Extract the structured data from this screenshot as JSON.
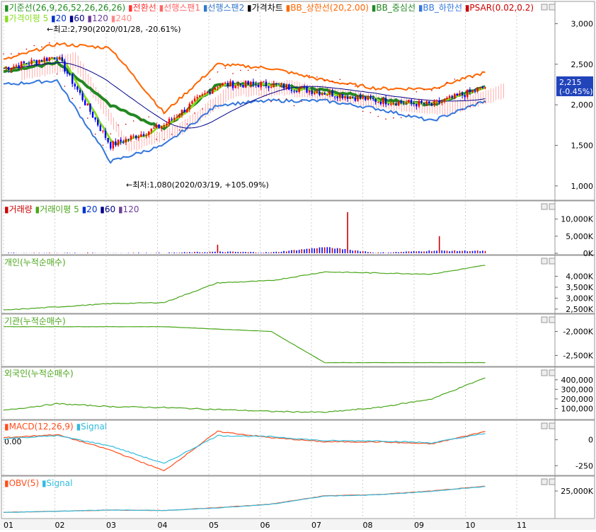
{
  "colors": {
    "kijun": "#1e8c1e",
    "tenkan": "#ff3333",
    "span1": "#ff6666",
    "span2": "#3377cc",
    "price_up": "#ff0000",
    "price_down": "#0000ff",
    "bb_upper": "#ff6600",
    "bb_mid": "#228822",
    "bb_lower": "#3377dd",
    "psar": "#cc0000",
    "ma5": "#88dd22",
    "ma20": "#0033cc",
    "ma60": "#000088",
    "ma120": "#6a3d9a",
    "ma240": "#ff8a8a",
    "vol": "#cc0000",
    "macd": "#ff4d1a",
    "signal": "#33bbdd",
    "obv": "#ff4d1a",
    "cum": "#4aa61a",
    "grid": "#cfcfcf",
    "axis_bg": "#ffffff"
  },
  "price_panel": {
    "legend1": [
      {
        "text": "기준선(26,9,26,52,26,26,26)",
        "color": "#1e8c1e"
      },
      {
        "text": "전환선",
        "color": "#ff3333"
      },
      {
        "text": "선행스팬1",
        "color": "#ff6666"
      },
      {
        "text": "선행스팬2",
        "color": "#3377cc"
      },
      {
        "text": "가격차트",
        "color": "#000000"
      },
      {
        "text": "BB_상한선(20,2.00)",
        "color": "#ff6600"
      },
      {
        "text": "BB_중심선",
        "color": "#228822"
      },
      {
        "text": "BB_하한선",
        "color": "#3377dd"
      },
      {
        "text": "PSAR(0.02,0.2)",
        "color": "#cc0000"
      }
    ],
    "legend2": [
      {
        "text": "가격이평 5",
        "color": "#88dd22"
      },
      {
        "text": "20",
        "color": "#0033cc"
      },
      {
        "text": "60",
        "color": "#000088"
      },
      {
        "text": "120",
        "color": "#6a3d9a"
      },
      {
        "text": "240",
        "color": "#ff8a8a"
      }
    ],
    "high_annotation": "←최고:2,790(2020/01/28, -20.61%)",
    "low_annotation": "←최저:1,080(2020/03/19, +105.09%)",
    "yticks": [
      "3,000",
      "2,500",
      "2,000",
      "1,500",
      "1,000"
    ],
    "current_price": "2,215",
    "current_change": "(-0.45%)"
  },
  "volume_panel": {
    "legend": [
      {
        "text": "거래량",
        "color": "#cc0000"
      },
      {
        "text": "거래이평 5",
        "color": "#4aa61a"
      },
      {
        "text": "20",
        "color": "#0033cc"
      },
      {
        "text": "60",
        "color": "#000088"
      },
      {
        "text": "120",
        "color": "#6a3d9a"
      }
    ],
    "yticks": [
      "10,000K",
      "5,000K",
      "0K"
    ]
  },
  "retail_panel": {
    "legend": "개인(누적순매수)",
    "yticks": [
      "4,000K",
      "3,500K",
      "3,000K",
      "2,500K"
    ]
  },
  "inst_panel": {
    "legend": "기관(누적순매수)",
    "yticks": [
      "-2,000K",
      "-2,500K"
    ]
  },
  "foreign_panel": {
    "legend": "외국인(누적순매수)",
    "yticks": [
      "400,000",
      "300,000",
      "200,000",
      "100,000"
    ]
  },
  "macd_panel": {
    "legend": [
      {
        "text": "MACD(12,26,9)",
        "color": "#ff4d1a"
      },
      {
        "text": "Signal",
        "color": "#33bbdd"
      }
    ],
    "zero_label": "0.00",
    "yticks": [
      "0",
      "-250"
    ]
  },
  "obv_panel": {
    "legend": [
      {
        "text": "OBV(5)",
        "color": "#ff4d1a"
      },
      {
        "text": "Signal",
        "color": "#33bbdd"
      }
    ],
    "yticks": [
      "25,000K"
    ]
  },
  "x_axis": [
    "01",
    "02",
    "03",
    "04",
    "05",
    "06",
    "07",
    "08",
    "09",
    "10",
    "11"
  ],
  "chart_data": [
    {
      "type": "line",
      "title": "",
      "series": [
        {
          "name": "가격차트",
          "kind": "candlestick",
          "x": [
            "01",
            "02",
            "03",
            "04",
            "05",
            "06",
            "07",
            "08",
            "09",
            "10"
          ],
          "values": [
            2450,
            2600,
            1500,
            1750,
            2250,
            2250,
            2150,
            2050,
            2000,
            2215
          ]
        },
        {
          "name": "BB_상한선",
          "x": [
            "01",
            "02",
            "03",
            "04",
            "05",
            "06",
            "07",
            "08",
            "09",
            "10"
          ],
          "values": [
            2550,
            2750,
            2700,
            1900,
            2500,
            2450,
            2300,
            2200,
            2200,
            2400
          ]
        },
        {
          "name": "BB_하한선",
          "x": [
            "01",
            "02",
            "03",
            "04",
            "05",
            "06",
            "07",
            "08",
            "09",
            "10"
          ],
          "values": [
            2250,
            2300,
            1300,
            1500,
            2000,
            2050,
            2050,
            1950,
            1800,
            2050
          ]
        }
      ],
      "price_high": 2790,
      "price_low": 1080,
      "current": 2215,
      "ylim": [
        850,
        3100
      ]
    },
    {
      "type": "bar",
      "title": "",
      "series": [
        {
          "name": "거래량",
          "x": [
            "01",
            "02",
            "03",
            "04",
            "05",
            "06",
            "07",
            "08",
            "09",
            "10"
          ],
          "values": [
            200,
            300,
            400,
            350,
            3000,
            1500,
            12000,
            800,
            5000,
            4500
          ]
        }
      ],
      "ylim": [
        0,
        12000
      ]
    },
    {
      "type": "line",
      "title": "",
      "series": [
        {
          "name": "개인(누적순매수)",
          "x": [
            "01",
            "02",
            "03",
            "04",
            "05",
            "06",
            "07",
            "08",
            "09",
            "10"
          ],
          "values": [
            2450,
            2600,
            2750,
            2800,
            3700,
            3800,
            4200,
            4150,
            4100,
            4500
          ]
        }
      ],
      "ylim": [
        2400,
        4600
      ]
    },
    {
      "type": "line",
      "title": "",
      "series": [
        {
          "name": "기관(누적순매수)",
          "x": [
            "01",
            "02",
            "03",
            "04",
            "05",
            "06",
            "07",
            "08",
            "09",
            "10"
          ],
          "values": [
            -1900,
            -1900,
            -1900,
            -1900,
            -1950,
            -2000,
            -2650,
            -2650,
            -2650,
            -2650
          ]
        }
      ],
      "ylim": [
        -2700,
        -1800
      ]
    },
    {
      "type": "line",
      "title": "",
      "series": [
        {
          "name": "외국인(누적순매수)",
          "x": [
            "01",
            "02",
            "03",
            "04",
            "05",
            "06",
            "07",
            "08",
            "09",
            "10"
          ],
          "values": [
            80000,
            150000,
            120000,
            110000,
            90000,
            70000,
            60000,
            110000,
            200000,
            420000
          ]
        }
      ],
      "ylim": [
        0,
        450000
      ]
    },
    {
      "type": "line",
      "title": "",
      "series": [
        {
          "name": "MACD(12,26,9)",
          "x": [
            "01",
            "02",
            "03",
            "04",
            "05",
            "06",
            "07",
            "08",
            "09",
            "10"
          ],
          "values": [
            20,
            50,
            -100,
            -300,
            80,
            20,
            -20,
            -20,
            -40,
            80
          ]
        },
        {
          "name": "Signal",
          "x": [
            "01",
            "02",
            "03",
            "04",
            "05",
            "06",
            "07",
            "08",
            "09",
            "10"
          ],
          "values": [
            10,
            40,
            -60,
            -230,
            40,
            30,
            -10,
            -10,
            -30,
            60
          ]
        }
      ],
      "ylim": [
        -330,
        120
      ]
    },
    {
      "type": "line",
      "title": "",
      "series": [
        {
          "name": "OBV(5)",
          "x": [
            "01",
            "02",
            "03",
            "04",
            "05",
            "06",
            "07",
            "08",
            "09",
            "10"
          ],
          "values": [
            16000,
            16500,
            17000,
            16800,
            18000,
            19500,
            23000,
            23500,
            25000,
            27000
          ]
        },
        {
          "name": "Signal",
          "x": [
            "01",
            "02",
            "03",
            "04",
            "05",
            "06",
            "07",
            "08",
            "09",
            "10"
          ],
          "values": [
            16000,
            16500,
            17000,
            16800,
            17900,
            19400,
            22900,
            23400,
            24900,
            26900
          ]
        }
      ],
      "ylim": [
        14000,
        28000
      ]
    }
  ]
}
